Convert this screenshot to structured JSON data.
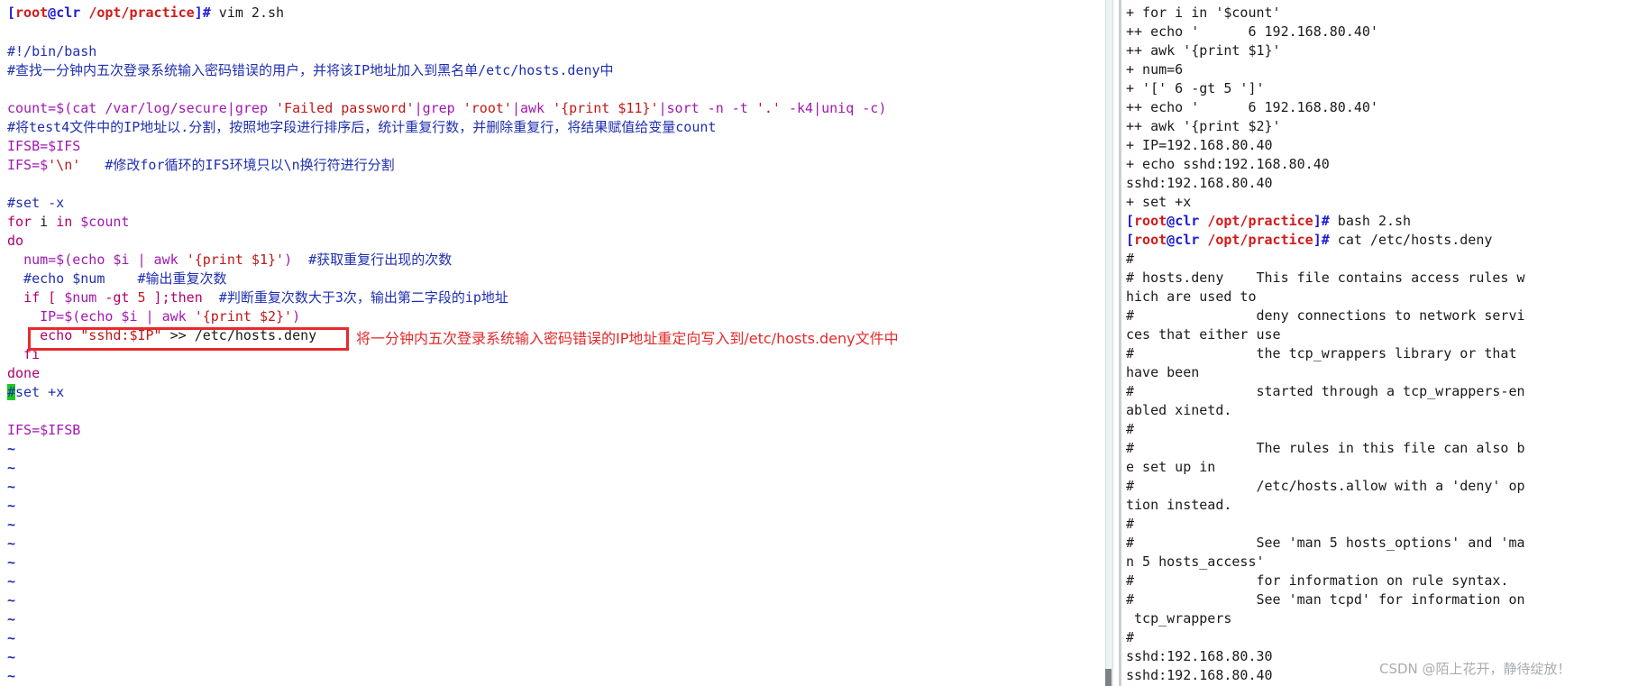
{
  "left_terminal": {
    "prompt": {
      "open": "[",
      "user": "root",
      "at": "@",
      "host": "clr",
      "path": "/opt/practice",
      "close": "]#",
      "command": " vim 2.sh"
    },
    "shebang": "#!/bin/bash",
    "comment_header": "#查找一分钟内五次登录系统输入密码错误的用户，并将该IP地址加入到黑名单/etc/hosts.deny中",
    "count_line": {
      "var": "count",
      "op": "=$(cat /var/log/secure|grep ",
      "s1": "'Failed password'",
      "p2": "|grep ",
      "s2": "'root'",
      "p3": "|awk ",
      "s3": "'{print $11}'",
      "p4": "|sort -n -t ",
      "s4": "'.'",
      "p5": " -k4|uniq -c)"
    },
    "comment_test4": "#将test4文件中的IP地址以.分割，按照地字段进行排序后，统计重复行数，并删除重复行，将结果赋值给变量count",
    "ifsb_line": "IFSB=$IFS",
    "ifs_line": {
      "a": "IFS=$",
      "b": "'\\n'",
      "c": "   #修改for循环的IFS环境只以\\n换行符进行分割"
    },
    "set_x_comment": "#set -x",
    "for_line": {
      "kw1": "for",
      "mid": " i ",
      "kw2": "in",
      "var": " $count"
    },
    "do_line": "do",
    "num_line": {
      "indent": "  ",
      "a": "num=$(echo $i | awk ",
      "b": "'{print $1}'",
      "c": ")  ",
      "cmt": "#获取重复行出现的次数"
    },
    "echo_num_line": "  #echo $num    #输出重复次数",
    "if_line": {
      "indent": "  ",
      "kw": "if",
      "a": " [ ",
      "b": "$num",
      "c": " -gt ",
      "d": "5",
      "e": " ];",
      "kw2": "then",
      "cmt": "  #判断重复次数大于3次，输出第二字段的ip地址"
    },
    "ip_line": {
      "indent": "    ",
      "a": "IP=$(echo $i | awk ",
      "b": "'{print $2}'",
      "c": ")"
    },
    "echo_line": {
      "indent": "    ",
      "kw": "echo",
      "sp": " ",
      "str": "\"sshd:$IP\"",
      "rest": " >> /etc/hosts.deny"
    },
    "fi_line": "  fi",
    "done_line": "done",
    "set_x_end": {
      "cursor": "#",
      "rest": "set +x"
    },
    "ifs_restore": "IFS=$IFSB",
    "tilde": "~",
    "annotation": "将一分钟内五次登录系统输入密码错误的IP地址重定向写入到/etc/hosts.deny文件中"
  },
  "right_terminal": {
    "lines": [
      "+ for i in '$count'",
      "++ echo '      6 192.168.80.40'",
      "++ awk '{print $1}'",
      "+ num=6",
      "+ '[' 6 -gt 5 ']'",
      "++ echo '      6 192.168.80.40'",
      "++ awk '{print $2}'",
      "+ IP=192.168.80.40",
      "+ echo sshd:192.168.80.40",
      "sshd:192.168.80.40",
      "+ set +x"
    ],
    "prompt1": {
      "open": "[",
      "user": "root",
      "at": "@",
      "host": "clr",
      "path": "/opt/practice",
      "close": "]#",
      "command": " bash 2.sh"
    },
    "prompt2": {
      "open": "[",
      "user": "root",
      "at": "@",
      "host": "clr",
      "path": "/opt/practice",
      "close": "]#",
      "command": " cat /etc/hosts.deny"
    },
    "output": [
      "#",
      "# hosts.deny    This file contains access rules w",
      "hich are used to",
      "#               deny connections to network servi",
      "ces that either use",
      "#               the tcp_wrappers library or that",
      "have been",
      "#               started through a tcp_wrappers-en",
      "abled xinetd.",
      "#",
      "#               The rules in this file can also b",
      "e set up in",
      "#               /etc/hosts.allow with a 'deny' op",
      "tion instead.",
      "#",
      "#               See 'man 5 hosts_options' and 'ma",
      "n 5 hosts_access'",
      "#               for information on rule syntax.",
      "#               See 'man tcpd' for information on",
      " tcp_wrappers",
      "#",
      "sshd:192.168.80.30",
      "sshd:192.168.80.40"
    ]
  },
  "watermark": "CSDN @陌上花开，静待绽放！"
}
